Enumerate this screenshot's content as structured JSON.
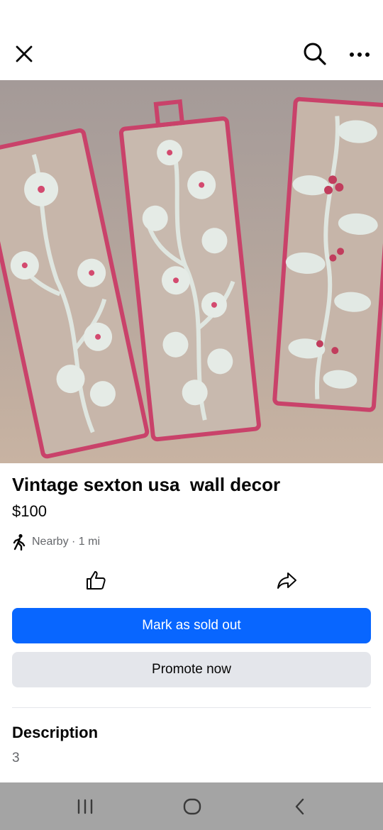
{
  "header": {
    "close_icon": "close-icon",
    "search_icon": "search-icon",
    "more_icon": "more-icon"
  },
  "photo": {
    "description_icon": "listing-photo",
    "page_count": 2,
    "current_page": 1
  },
  "listing": {
    "title": "Vintage sexton usa  wall decor",
    "price": "$100",
    "location": "Nearby · 1 mi",
    "location_icon": "walking-person-icon"
  },
  "actions": {
    "like_icon": "thumbs-up-icon",
    "share_icon": "share-icon",
    "mark_sold_label": "Mark as sold out",
    "promote_label": "Promote now"
  },
  "description": {
    "heading": "Description",
    "text": "3"
  },
  "colors": {
    "primary": "#0866ff",
    "secondary": "#e4e6eb",
    "nav_bar": "#a4a4a4"
  },
  "system_nav": {
    "recents_icon": "recents-icon",
    "home_icon": "home-icon",
    "back_icon": "back-icon"
  }
}
